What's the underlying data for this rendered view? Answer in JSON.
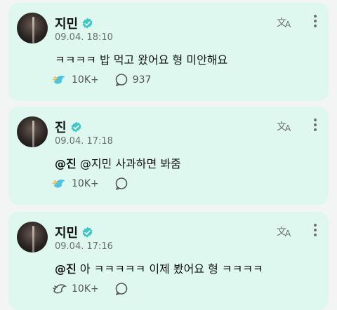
{
  "posts": [
    {
      "author": "지민",
      "time": "09.04. 18:10",
      "mention": "",
      "text": "ㅋㅋㅋㅋ 밥 먹고 왔어요 형 미안해요",
      "likes": "10K+",
      "comments": "937",
      "like_active": true
    },
    {
      "author": "진",
      "time": "09.04. 17:18",
      "mention": "@진",
      "text": "@지민 사과하면 봐줌",
      "likes": "10K+",
      "comments": "",
      "like_active": true
    },
    {
      "author": "지민",
      "time": "09.04. 17:16",
      "mention": "@진",
      "text": "아 ㅋㅋㅋㅋㅋ 이제 봤어요 형 ㅋㅋㅋㅋ",
      "likes": "10K+",
      "comments": "",
      "like_active": false
    }
  ],
  "icons": {
    "translate": "translate-icon",
    "more": "more-vert-icon",
    "like": "like-icon",
    "comment": "comment-icon",
    "verified": "verified-badge-icon"
  },
  "colors": {
    "card_bg": "#def8ef",
    "verified": "#3fc6c8",
    "like_active": "#4dc4e4"
  }
}
